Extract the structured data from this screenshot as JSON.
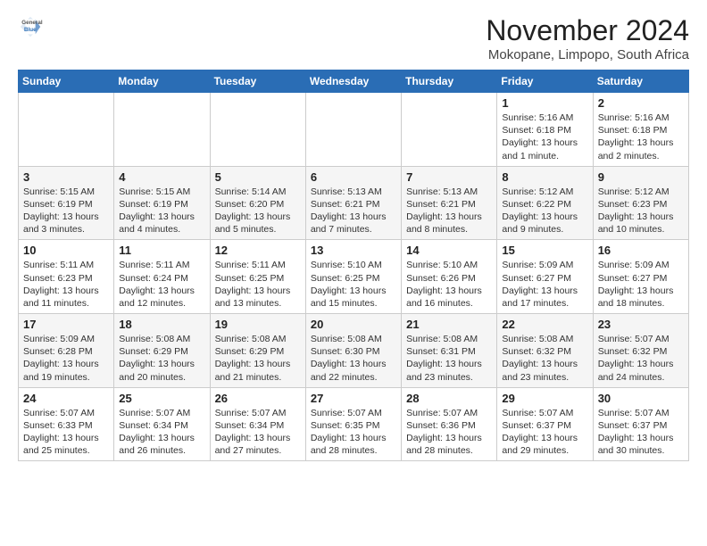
{
  "header": {
    "logo": {
      "general": "General",
      "blue": "Blue"
    },
    "title": "November 2024",
    "subtitle": "Mokopane, Limpopo, South Africa"
  },
  "calendar": {
    "days_of_week": [
      "Sunday",
      "Monday",
      "Tuesday",
      "Wednesday",
      "Thursday",
      "Friday",
      "Saturday"
    ],
    "weeks": [
      [
        {
          "day": "",
          "info": ""
        },
        {
          "day": "",
          "info": ""
        },
        {
          "day": "",
          "info": ""
        },
        {
          "day": "",
          "info": ""
        },
        {
          "day": "",
          "info": ""
        },
        {
          "day": "1",
          "info": "Sunrise: 5:16 AM\nSunset: 6:18 PM\nDaylight: 13 hours\nand 1 minute."
        },
        {
          "day": "2",
          "info": "Sunrise: 5:16 AM\nSunset: 6:18 PM\nDaylight: 13 hours\nand 2 minutes."
        }
      ],
      [
        {
          "day": "3",
          "info": "Sunrise: 5:15 AM\nSunset: 6:19 PM\nDaylight: 13 hours\nand 3 minutes."
        },
        {
          "day": "4",
          "info": "Sunrise: 5:15 AM\nSunset: 6:19 PM\nDaylight: 13 hours\nand 4 minutes."
        },
        {
          "day": "5",
          "info": "Sunrise: 5:14 AM\nSunset: 6:20 PM\nDaylight: 13 hours\nand 5 minutes."
        },
        {
          "day": "6",
          "info": "Sunrise: 5:13 AM\nSunset: 6:21 PM\nDaylight: 13 hours\nand 7 minutes."
        },
        {
          "day": "7",
          "info": "Sunrise: 5:13 AM\nSunset: 6:21 PM\nDaylight: 13 hours\nand 8 minutes."
        },
        {
          "day": "8",
          "info": "Sunrise: 5:12 AM\nSunset: 6:22 PM\nDaylight: 13 hours\nand 9 minutes."
        },
        {
          "day": "9",
          "info": "Sunrise: 5:12 AM\nSunset: 6:23 PM\nDaylight: 13 hours\nand 10 minutes."
        }
      ],
      [
        {
          "day": "10",
          "info": "Sunrise: 5:11 AM\nSunset: 6:23 PM\nDaylight: 13 hours\nand 11 minutes."
        },
        {
          "day": "11",
          "info": "Sunrise: 5:11 AM\nSunset: 6:24 PM\nDaylight: 13 hours\nand 12 minutes."
        },
        {
          "day": "12",
          "info": "Sunrise: 5:11 AM\nSunset: 6:25 PM\nDaylight: 13 hours\nand 13 minutes."
        },
        {
          "day": "13",
          "info": "Sunrise: 5:10 AM\nSunset: 6:25 PM\nDaylight: 13 hours\nand 15 minutes."
        },
        {
          "day": "14",
          "info": "Sunrise: 5:10 AM\nSunset: 6:26 PM\nDaylight: 13 hours\nand 16 minutes."
        },
        {
          "day": "15",
          "info": "Sunrise: 5:09 AM\nSunset: 6:27 PM\nDaylight: 13 hours\nand 17 minutes."
        },
        {
          "day": "16",
          "info": "Sunrise: 5:09 AM\nSunset: 6:27 PM\nDaylight: 13 hours\nand 18 minutes."
        }
      ],
      [
        {
          "day": "17",
          "info": "Sunrise: 5:09 AM\nSunset: 6:28 PM\nDaylight: 13 hours\nand 19 minutes."
        },
        {
          "day": "18",
          "info": "Sunrise: 5:08 AM\nSunset: 6:29 PM\nDaylight: 13 hours\nand 20 minutes."
        },
        {
          "day": "19",
          "info": "Sunrise: 5:08 AM\nSunset: 6:29 PM\nDaylight: 13 hours\nand 21 minutes."
        },
        {
          "day": "20",
          "info": "Sunrise: 5:08 AM\nSunset: 6:30 PM\nDaylight: 13 hours\nand 22 minutes."
        },
        {
          "day": "21",
          "info": "Sunrise: 5:08 AM\nSunset: 6:31 PM\nDaylight: 13 hours\nand 23 minutes."
        },
        {
          "day": "22",
          "info": "Sunrise: 5:08 AM\nSunset: 6:32 PM\nDaylight: 13 hours\nand 23 minutes."
        },
        {
          "day": "23",
          "info": "Sunrise: 5:07 AM\nSunset: 6:32 PM\nDaylight: 13 hours\nand 24 minutes."
        }
      ],
      [
        {
          "day": "24",
          "info": "Sunrise: 5:07 AM\nSunset: 6:33 PM\nDaylight: 13 hours\nand 25 minutes."
        },
        {
          "day": "25",
          "info": "Sunrise: 5:07 AM\nSunset: 6:34 PM\nDaylight: 13 hours\nand 26 minutes."
        },
        {
          "day": "26",
          "info": "Sunrise: 5:07 AM\nSunset: 6:34 PM\nDaylight: 13 hours\nand 27 minutes."
        },
        {
          "day": "27",
          "info": "Sunrise: 5:07 AM\nSunset: 6:35 PM\nDaylight: 13 hours\nand 28 minutes."
        },
        {
          "day": "28",
          "info": "Sunrise: 5:07 AM\nSunset: 6:36 PM\nDaylight: 13 hours\nand 28 minutes."
        },
        {
          "day": "29",
          "info": "Sunrise: 5:07 AM\nSunset: 6:37 PM\nDaylight: 13 hours\nand 29 minutes."
        },
        {
          "day": "30",
          "info": "Sunrise: 5:07 AM\nSunset: 6:37 PM\nDaylight: 13 hours\nand 30 minutes."
        }
      ]
    ]
  }
}
